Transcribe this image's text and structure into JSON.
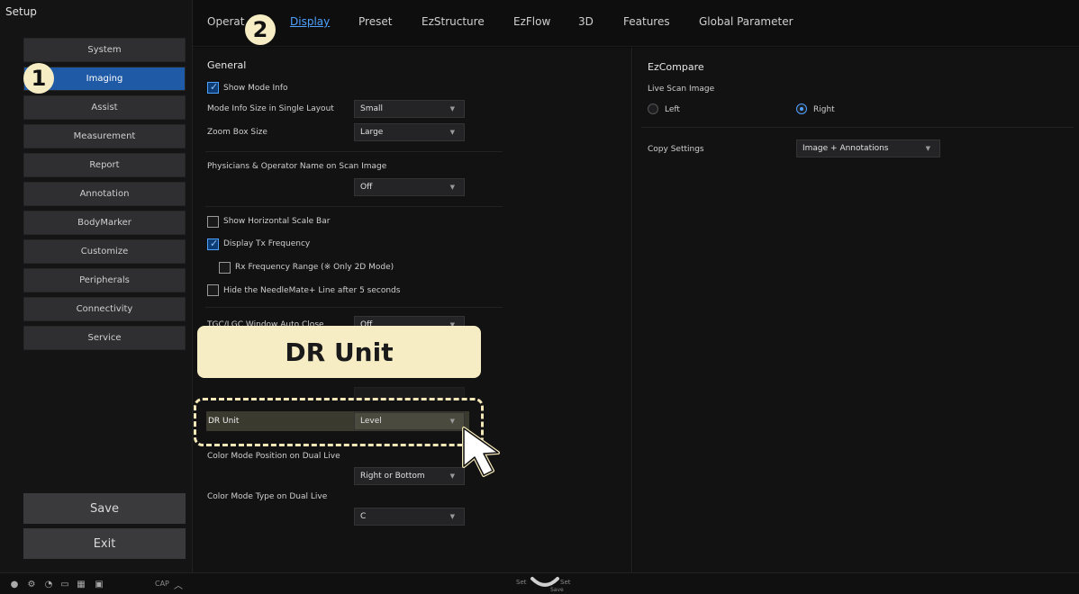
{
  "sidebar": {
    "title": "Setup",
    "items": [
      {
        "label": "System",
        "active": false
      },
      {
        "label": "Imaging",
        "active": true
      },
      {
        "label": "Assist",
        "active": false
      },
      {
        "label": "Measurement",
        "active": false
      },
      {
        "label": "Report",
        "active": false
      },
      {
        "label": "Annotation",
        "active": false
      },
      {
        "label": "BodyMarker",
        "active": false
      },
      {
        "label": "Customize",
        "active": false
      },
      {
        "label": "Peripherals",
        "active": false
      },
      {
        "label": "Connectivity",
        "active": false
      },
      {
        "label": "Service",
        "active": false
      }
    ],
    "save_label": "Save",
    "exit_label": "Exit"
  },
  "tabs": [
    {
      "label": "Operat",
      "active": false
    },
    {
      "label": "Display",
      "active": true
    },
    {
      "label": "Preset",
      "active": false
    },
    {
      "label": "EzStructure",
      "active": false
    },
    {
      "label": "EzFlow",
      "active": false
    },
    {
      "label": "3D",
      "active": false
    },
    {
      "label": "Features",
      "active": false
    },
    {
      "label": "Global Parameter",
      "active": false
    }
  ],
  "general": {
    "title": "General",
    "show_mode_info": {
      "label": "Show Mode Info",
      "checked": true
    },
    "mode_info_size": {
      "label": "Mode Info Size in Single Layout",
      "value": "Small"
    },
    "zoom_box_size": {
      "label": "Zoom Box Size",
      "value": "Large"
    },
    "physicians_name": {
      "label": "Physicians & Operator Name on Scan Image",
      "value": "Off"
    },
    "show_hscale": {
      "label": "Show Horizontal Scale Bar",
      "checked": false
    },
    "display_tx": {
      "label": "Display Tx Frequency",
      "checked": true
    },
    "rx_range": {
      "label": "Rx Frequency Range (※ Only 2D Mode)",
      "checked": false
    },
    "hide_needle": {
      "label": "Hide the NeedleMate+ Line after 5 seconds",
      "checked": false
    },
    "tgc_close": {
      "label": "TGC/LGC Window Auto Close",
      "value": "Off"
    },
    "dr_unit": {
      "label": "DR Unit",
      "value": "Level"
    },
    "color_position": {
      "label": "Color Mode Position on Dual Live",
      "value": "Right or Bottom"
    },
    "color_type": {
      "label": "Color Mode Type on Dual Live",
      "value": "C"
    }
  },
  "ezcompare": {
    "title": "EzCompare",
    "live_scan_label": "Live Scan Image",
    "left_label": "Left",
    "right_label": "Right",
    "selected": "Right",
    "copy_settings_label": "Copy Settings",
    "copy_settings_value": "Image + Annotations"
  },
  "statusbar": {
    "cap_label": "CAP",
    "set_left": "Set",
    "set_right": "Set",
    "save_label": "Save"
  },
  "overlay": {
    "callout_1": "1",
    "callout_2": "2",
    "banner": "DR Unit"
  },
  "colors": {
    "accent": "#4ea1ff",
    "active_sidebar": "#1f5aa6",
    "callout_bg": "#f6edc4"
  }
}
